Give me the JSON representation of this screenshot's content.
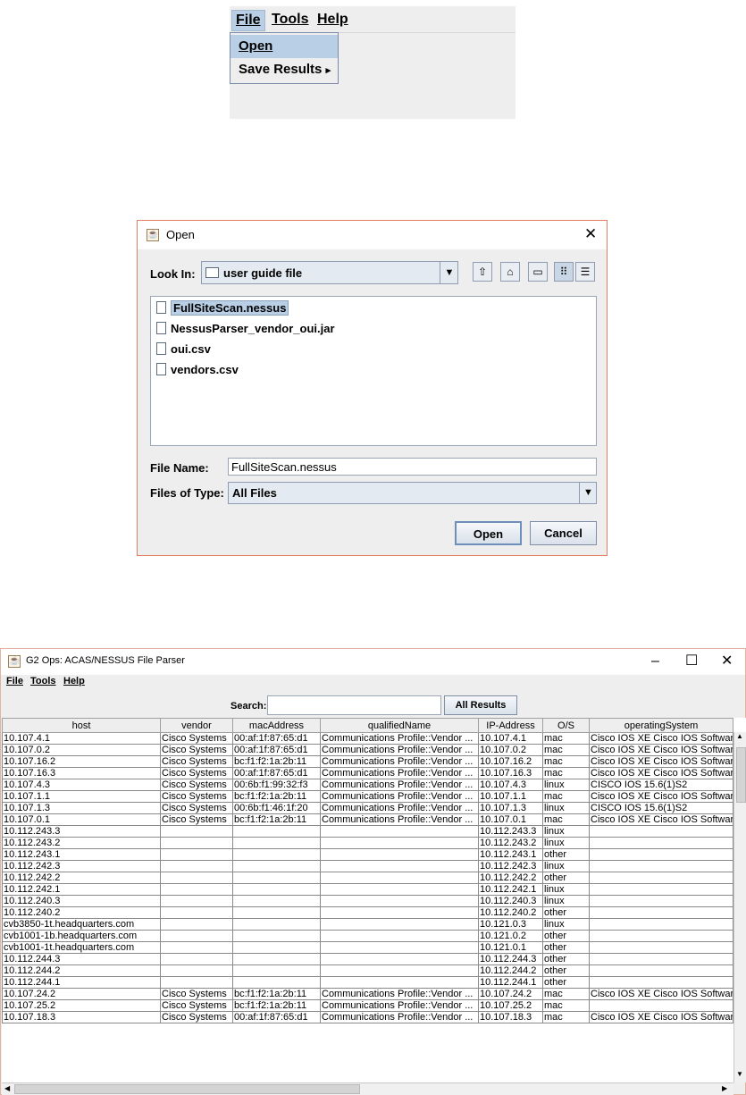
{
  "menu_shot": {
    "menubar": [
      {
        "label": "File",
        "selected": true
      },
      {
        "label": "Tools",
        "selected": false
      },
      {
        "label": "Help",
        "selected": false
      }
    ],
    "dropdown": [
      {
        "label": "Open",
        "selected": true
      },
      {
        "label": "Save Results",
        "submenu_arrow": "▸"
      }
    ]
  },
  "open_dialog": {
    "title": "Open",
    "look_in_label": "Look In:",
    "look_in_value": "user guide file",
    "files": [
      {
        "name": "FullSiteScan.nessus",
        "selected": true
      },
      {
        "name": "NessusParser_vendor_oui.jar",
        "selected": false
      },
      {
        "name": "oui.csv",
        "selected": false
      },
      {
        "name": "vendors.csv",
        "selected": false
      }
    ],
    "file_name_label": "File Name:",
    "file_name_value": "FullSiteScan.nessus",
    "files_of_type_label": "Files of Type:",
    "files_of_type_value": "All Files",
    "open_button": "Open",
    "cancel_button": "Cancel",
    "close_glyph": "✕",
    "toolbar_icons": [
      "up-folder-icon",
      "home-icon",
      "new-folder-icon",
      "list-view-icon",
      "details-view-icon"
    ]
  },
  "app_window": {
    "title": "G2 Ops: ACAS/NESSUS File Parser",
    "controls": {
      "minimize": "–",
      "maximize": "☐",
      "close": "✕"
    },
    "menu": [
      "File",
      "Tools",
      "Help"
    ],
    "search_label": "Search:",
    "search_value": "",
    "all_results_button": "All Results",
    "columns": [
      "host",
      "vendor",
      "macAddress",
      "qualifiedName",
      "IP-Address",
      "O/S",
      "operatingSystem"
    ],
    "rows": [
      [
        "10.107.4.1",
        "Cisco Systems",
        "00:af:1f:87:65:d1",
        "Communications Profile::Vendor ...",
        "10.107.4.1",
        "mac",
        "Cisco IOS XE Cisco IOS Software"
      ],
      [
        "10.107.0.2",
        "Cisco Systems",
        "00:af:1f:87:65:d1",
        "Communications Profile::Vendor ...",
        "10.107.0.2",
        "mac",
        "Cisco IOS XE Cisco IOS Software"
      ],
      [
        "10.107.16.2",
        "Cisco Systems",
        "bc:f1:f2:1a:2b:11",
        "Communications Profile::Vendor ...",
        "10.107.16.2",
        "mac",
        "Cisco IOS XE Cisco IOS Software"
      ],
      [
        "10.107.16.3",
        "Cisco Systems",
        "00:af:1f:87:65:d1",
        "Communications Profile::Vendor ...",
        "10.107.16.3",
        "mac",
        "Cisco IOS XE Cisco IOS Software"
      ],
      [
        "10.107.4.3",
        "Cisco Systems",
        "00:6b:f1:99:32:f3",
        "Communications Profile::Vendor ...",
        "10.107.4.3",
        "linux",
        "CISCO IOS 15.6(1)S2"
      ],
      [
        "10.107.1.1",
        "Cisco Systems",
        "bc:f1:f2:1a:2b:11",
        "Communications Profile::Vendor ...",
        "10.107.1.1",
        "mac",
        "Cisco IOS XE Cisco IOS Software"
      ],
      [
        "10.107.1.3",
        "Cisco Systems",
        "00:6b:f1:46:1f:20",
        "Communications Profile::Vendor ...",
        "10.107.1.3",
        "linux",
        "CISCO IOS 15.6(1)S2"
      ],
      [
        "10.107.0.1",
        "Cisco Systems",
        "bc:f1:f2:1a:2b:11",
        "Communications Profile::Vendor ...",
        "10.107.0.1",
        "mac",
        "Cisco IOS XE Cisco IOS Software"
      ],
      [
        "10.112.243.3",
        "",
        "",
        "",
        "10.112.243.3",
        "linux",
        ""
      ],
      [
        "10.112.243.2",
        "",
        "",
        "",
        "10.112.243.2",
        "linux",
        ""
      ],
      [
        "10.112.243.1",
        "",
        "",
        "",
        "10.112.243.1",
        "other",
        ""
      ],
      [
        "10.112.242.3",
        "",
        "",
        "",
        "10.112.242.3",
        "linux",
        ""
      ],
      [
        "10.112.242.2",
        "",
        "",
        "",
        "10.112.242.2",
        "other",
        ""
      ],
      [
        "10.112.242.1",
        "",
        "",
        "",
        "10.112.242.1",
        "linux",
        ""
      ],
      [
        "10.112.240.3",
        "",
        "",
        "",
        "10.112.240.3",
        "linux",
        ""
      ],
      [
        "10.112.240.2",
        "",
        "",
        "",
        "10.112.240.2",
        "other",
        ""
      ],
      [
        "cvb3850-1t.headquarters.com",
        "",
        "",
        "",
        "10.121.0.3",
        "linux",
        ""
      ],
      [
        "cvb1001-1b.headquarters.com",
        "",
        "",
        "",
        "10.121.0.2",
        "other",
        ""
      ],
      [
        "cvb1001-1t.headquarters.com",
        "",
        "",
        "",
        "10.121.0.1",
        "other",
        ""
      ],
      [
        "10.112.244.3",
        "",
        "",
        "",
        "10.112.244.3",
        "other",
        ""
      ],
      [
        "10.112.244.2",
        "",
        "",
        "",
        "10.112.244.2",
        "other",
        ""
      ],
      [
        "10.112.244.1",
        "",
        "",
        "",
        "10.112.244.1",
        "other",
        ""
      ],
      [
        "10.107.24.2",
        "Cisco Systems",
        "bc:f1:f2:1a:2b:11",
        "Communications Profile::Vendor ...",
        "10.107.24.2",
        "mac",
        "Cisco IOS XE Cisco IOS Software"
      ],
      [
        "10.107.25.2",
        "Cisco Systems",
        "bc:f1:f2:1a:2b:11",
        "Communications Profile::Vendor ...",
        "10.107.25.2",
        "mac",
        ""
      ],
      [
        "10.107.18.3",
        "Cisco Systems",
        "00:af:1f:87:65:d1",
        "Communications Profile::Vendor ...",
        "10.107.18.3",
        "mac",
        "Cisco IOS XE Cisco IOS Software"
      ]
    ],
    "scroll_glyphs": {
      "up": "▲",
      "down": "▼",
      "left": "◀",
      "right": "▶"
    }
  }
}
